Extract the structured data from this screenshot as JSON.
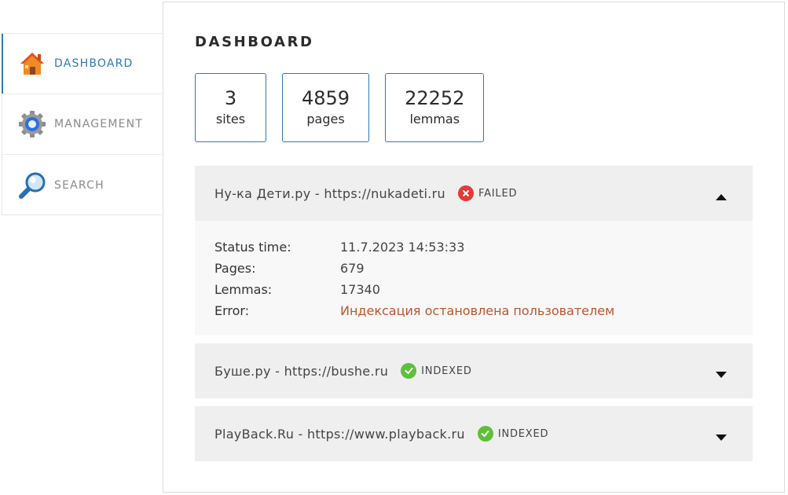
{
  "sidebar": {
    "items": [
      {
        "label": "DASHBOARD",
        "icon": "home-icon",
        "active": true
      },
      {
        "label": "MANAGEMENT",
        "icon": "gear-icon",
        "active": false
      },
      {
        "label": "SEARCH",
        "icon": "magnifier-icon",
        "active": false
      }
    ]
  },
  "main": {
    "title": "DASHBOARD",
    "stats": [
      {
        "value": "3",
        "label": "sites"
      },
      {
        "value": "4859",
        "label": "pages"
      },
      {
        "value": "22252",
        "label": "lemmas"
      }
    ],
    "sites": [
      {
        "name": "Ну-ка Дети.ру - https://nukadeti.ru",
        "status": "FAILED",
        "expanded": true,
        "details": {
          "status_time_label": "Status time:",
          "status_time": "11.7.2023 14:53:33",
          "pages_label": "Pages:",
          "pages": "679",
          "lemmas_label": "Lemmas:",
          "lemmas": "17340",
          "error_label": "Error:",
          "error": "Индексация остановлена пользователем"
        }
      },
      {
        "name": "Буше.ру - https://bushe.ru",
        "status": "INDEXED",
        "expanded": false
      },
      {
        "name": "PlayBack.Ru - https://www.playback.ru",
        "status": "INDEXED",
        "expanded": false
      }
    ]
  },
  "colors": {
    "accent": "#2f78b5",
    "failed": "#e53935",
    "indexed": "#5fbf3a",
    "error_text": "#c0542f"
  }
}
